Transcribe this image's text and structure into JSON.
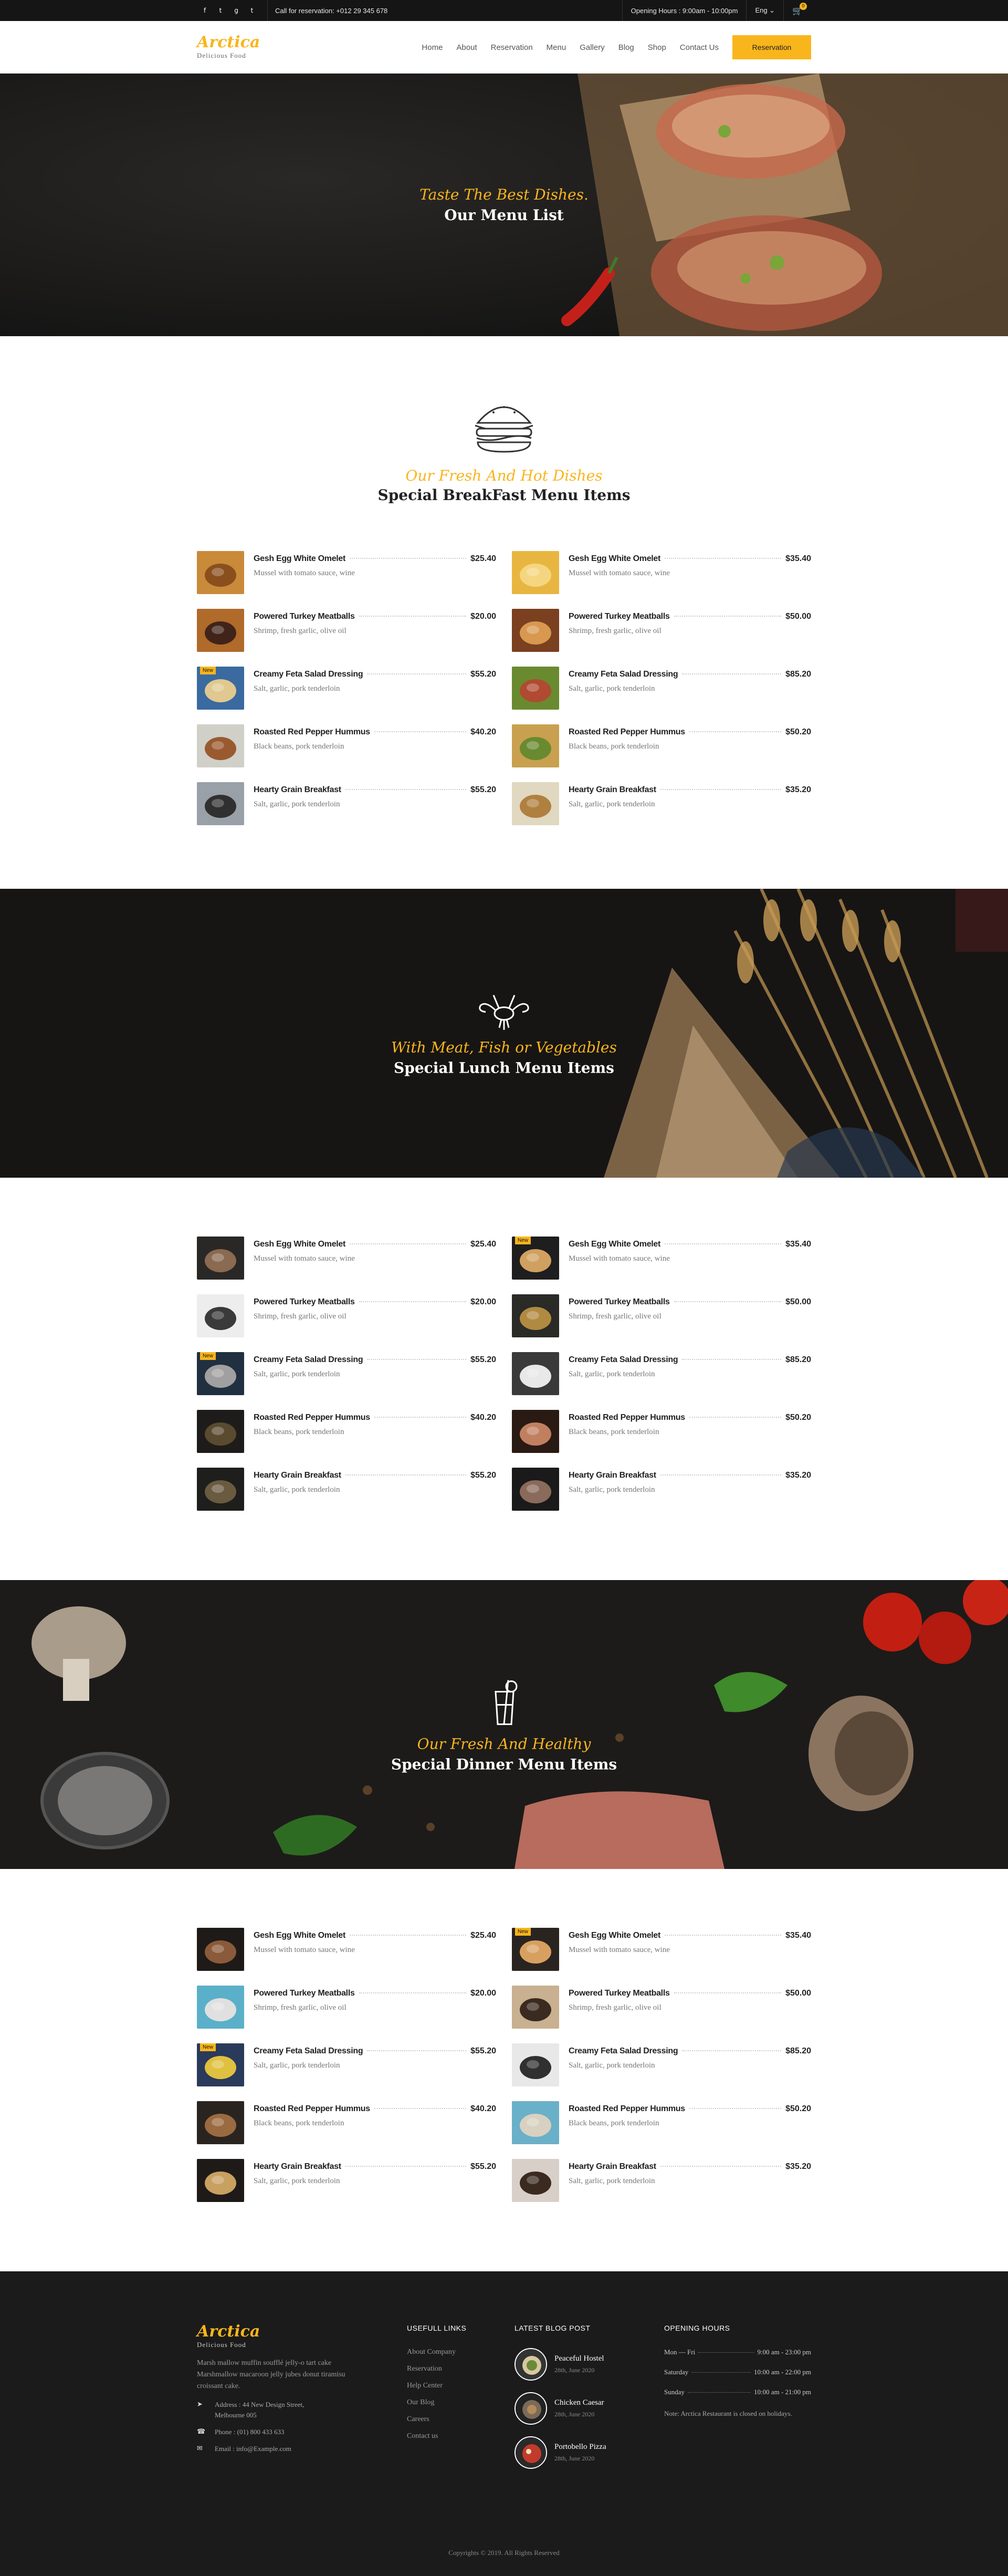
{
  "topbar": {
    "social": [
      "f",
      "t",
      "g",
      "t"
    ],
    "call_text": "Call for reservation: +012 29 345 678",
    "opening_text": "Opening Hours : 9:00am - 10:00pm",
    "language": "Eng ⌄",
    "cart_count": "0"
  },
  "header": {
    "logo_name": "Arctica",
    "logo_sub": "Delicious Food",
    "nav": [
      "Home",
      "About",
      "Reservation",
      "Menu",
      "Gallery",
      "Blog",
      "Shop",
      "Contact Us"
    ],
    "reservation_button": "Reservation"
  },
  "hero": {
    "script": "Taste The Best Dishes.",
    "title": "Our Menu List"
  },
  "breakfast": {
    "script": "Our Fresh And Hot Dishes",
    "title": "Special BreakFast Menu Items",
    "items": [
      {
        "name": "Gesh Egg White Omelet",
        "desc": "Mussel with tomato sauce, wine",
        "price": "$25.40",
        "badge": ""
      },
      {
        "name": "Gesh Egg White Omelet",
        "desc": "Mussel with tomato sauce, wine",
        "price": "$35.40",
        "badge": ""
      },
      {
        "name": "Powered Turkey Meatballs",
        "desc": "Shrimp, fresh garlic, olive oil",
        "price": "$20.00",
        "badge": ""
      },
      {
        "name": "Powered Turkey Meatballs",
        "desc": "Shrimp, fresh garlic, olive oil",
        "price": "$50.00",
        "badge": ""
      },
      {
        "name": "Creamy Feta Salad Dressing",
        "desc": "Salt, garlic, pork tenderloin",
        "price": "$55.20",
        "badge": "New"
      },
      {
        "name": "Creamy Feta Salad Dressing",
        "desc": "Salt, garlic, pork tenderloin",
        "price": "$85.20",
        "badge": ""
      },
      {
        "name": "Roasted Red Pepper Hummus",
        "desc": "Black beans, pork tenderloin",
        "price": "$40.20",
        "badge": ""
      },
      {
        "name": "Roasted Red Pepper Hummus",
        "desc": "Black beans, pork tenderloin",
        "price": "$50.20",
        "badge": ""
      },
      {
        "name": "Hearty Grain Breakfast",
        "desc": "Salt, garlic, pork tenderloin",
        "price": "$55.20",
        "badge": ""
      },
      {
        "name": "Hearty Grain Breakfast",
        "desc": "Salt, garlic, pork tenderloin",
        "price": "$35.20",
        "badge": ""
      }
    ]
  },
  "lunch": {
    "script": "With Meat, Fish or Vegetables",
    "title": "Special Lunch Menu Items",
    "items": [
      {
        "name": "Gesh Egg White Omelet",
        "desc": "Mussel with tomato sauce, wine",
        "price": "$25.40",
        "badge": ""
      },
      {
        "name": "Gesh Egg White Omelet",
        "desc": "Mussel with tomato sauce, wine",
        "price": "$35.40",
        "badge": "New"
      },
      {
        "name": "Powered Turkey Meatballs",
        "desc": "Shrimp, fresh garlic, olive oil",
        "price": "$20.00",
        "badge": ""
      },
      {
        "name": "Powered Turkey Meatballs",
        "desc": "Shrimp, fresh garlic, olive oil",
        "price": "$50.00",
        "badge": ""
      },
      {
        "name": "Creamy Feta Salad Dressing",
        "desc": "Salt, garlic, pork tenderloin",
        "price": "$55.20",
        "badge": "New"
      },
      {
        "name": "Creamy Feta Salad Dressing",
        "desc": "Salt, garlic, pork tenderloin",
        "price": "$85.20",
        "badge": ""
      },
      {
        "name": "Roasted Red Pepper Hummus",
        "desc": "Black beans, pork tenderloin",
        "price": "$40.20",
        "badge": ""
      },
      {
        "name": "Roasted Red Pepper Hummus",
        "desc": "Black beans, pork tenderloin",
        "price": "$50.20",
        "badge": ""
      },
      {
        "name": "Hearty Grain Breakfast",
        "desc": "Salt, garlic, pork tenderloin",
        "price": "$55.20",
        "badge": ""
      },
      {
        "name": "Hearty Grain Breakfast",
        "desc": "Salt, garlic, pork tenderloin",
        "price": "$35.20",
        "badge": ""
      }
    ]
  },
  "dinner": {
    "script": "Our Fresh And Healthy",
    "title": "Special Dinner Menu Items",
    "items": [
      {
        "name": "Gesh Egg White Omelet",
        "desc": "Mussel with tomato sauce, wine",
        "price": "$25.40",
        "badge": ""
      },
      {
        "name": "Gesh Egg White Omelet",
        "desc": "Mussel with tomato sauce, wine",
        "price": "$35.40",
        "badge": "New"
      },
      {
        "name": "Powered Turkey Meatballs",
        "desc": "Shrimp, fresh garlic, olive oil",
        "price": "$20.00",
        "badge": ""
      },
      {
        "name": "Powered Turkey Meatballs",
        "desc": "Shrimp, fresh garlic, olive oil",
        "price": "$50.00",
        "badge": ""
      },
      {
        "name": "Creamy Feta Salad Dressing",
        "desc": "Salt, garlic, pork tenderloin",
        "price": "$55.20",
        "badge": "New"
      },
      {
        "name": "Creamy Feta Salad Dressing",
        "desc": "Salt, garlic, pork tenderloin",
        "price": "$85.20",
        "badge": ""
      },
      {
        "name": "Roasted Red Pepper Hummus",
        "desc": "Black beans, pork tenderloin",
        "price": "$40.20",
        "badge": ""
      },
      {
        "name": "Roasted Red Pepper Hummus",
        "desc": "Black beans, pork tenderloin",
        "price": "$50.20",
        "badge": ""
      },
      {
        "name": "Hearty Grain Breakfast",
        "desc": "Salt, garlic, pork tenderloin",
        "price": "$55.20",
        "badge": ""
      },
      {
        "name": "Hearty Grain Breakfast",
        "desc": "Salt, garlic, pork tenderloin",
        "price": "$35.20",
        "badge": ""
      }
    ]
  },
  "footer": {
    "logo_name": "Arctica",
    "logo_sub": "Delicious Food",
    "about": "Marsh mallow muffin soufflé jelly-o tart cake Marshmallow macaroon jelly jubes donut tiramisu croissant cake.",
    "address": "Address : 44 New Design Street, Melbourne 005",
    "phone": "Phone : (01) 800 433 633",
    "email": "Email : info@Example.com",
    "links_title": "USEFULL LINKS",
    "links": [
      "About Company",
      "Reservation",
      "Help Center",
      "Our Blog",
      "Careers",
      "Contact us"
    ],
    "blog_title": "LATEST BLOG POST",
    "posts": [
      {
        "title": "Peaceful Hostel",
        "date": "28th, June 2020"
      },
      {
        "title": "Chicken Caesar",
        "date": "28th, June 2020"
      },
      {
        "title": "Portobello Pizza",
        "date": "28th, June 2020"
      }
    ],
    "hours_title": "OPENING HOURS",
    "hours": [
      {
        "day": "Mon — Fri",
        "time": "9:00 am - 23:00 pm"
      },
      {
        "day": "Saturday",
        "time": "10:00 am - 22:00 pm"
      },
      {
        "day": "Sunday",
        "time": "10:00 am - 21:00 pm"
      }
    ],
    "note": "Note: Arctica Restaurant is closed on holidays.",
    "copyright": "Copyrights © 2019. All Rights Reserved"
  },
  "colors": {
    "accent": "#f9b51c",
    "dark": "#151515",
    "footer": "#1b1b1b"
  }
}
